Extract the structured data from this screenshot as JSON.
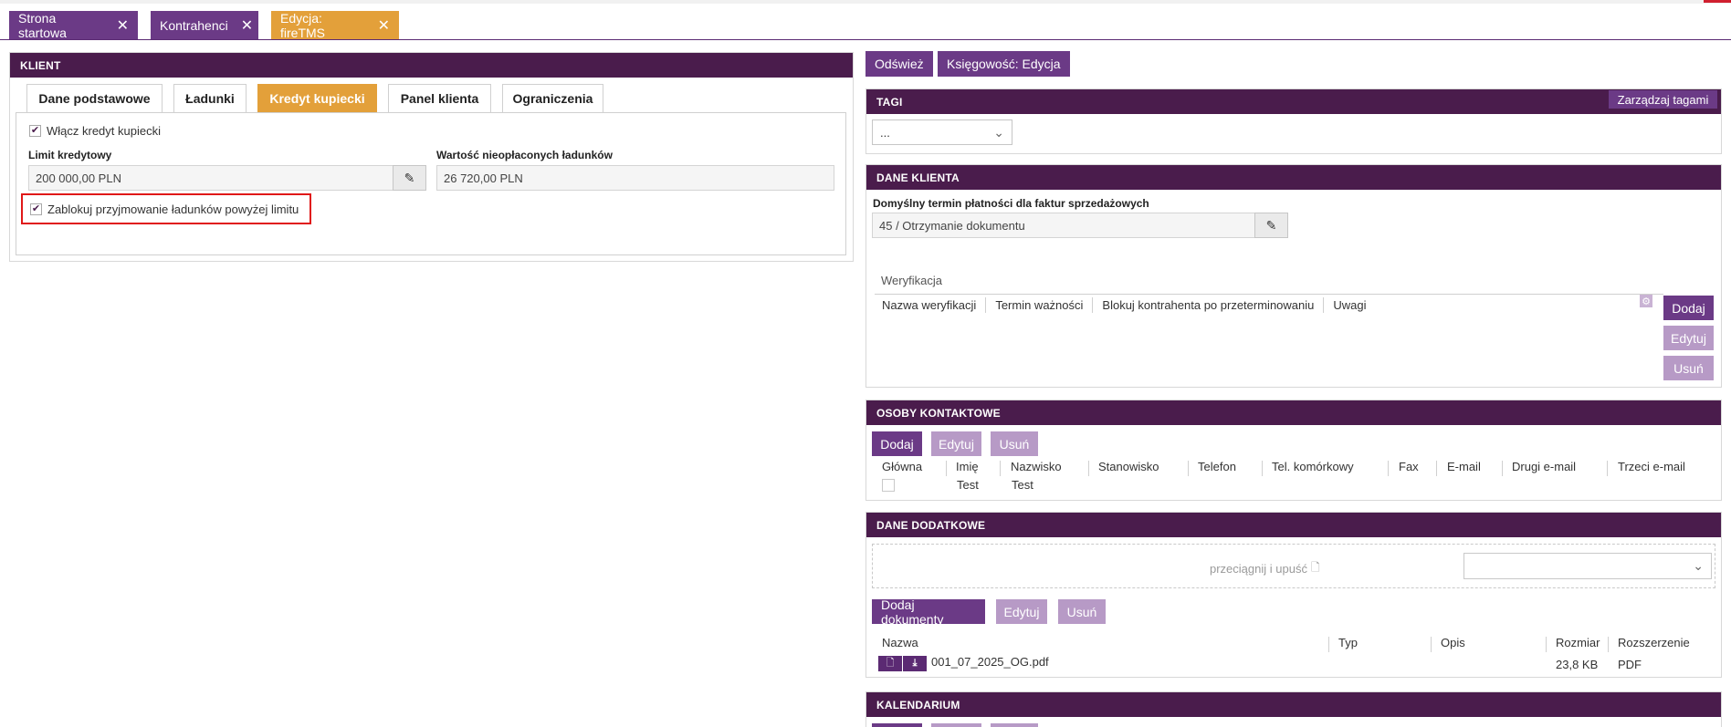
{
  "tabs": [
    {
      "label": "Strona startowa"
    },
    {
      "label": "Kontrahenci"
    },
    {
      "label": "Edycja: fireTMS"
    }
  ],
  "client": {
    "title": "KLIENT",
    "subtabs": [
      "Dane podstawowe",
      "Ładunki",
      "Kredyt kupiecki",
      "Panel klienta",
      "Ograniczenia"
    ],
    "enable_credit_label": "Włącz kredyt kupiecki",
    "credit_limit_label": "Limit kredytowy",
    "credit_limit_value": "200 000,00 PLN",
    "unpaid_label": "Wartość nieopłaconych ładunków",
    "unpaid_value": "26 720,00 PLN",
    "block_label": "Zablokuj przyjmowanie ładunków powyżej limitu"
  },
  "toolbar": {
    "refresh": "Odśwież",
    "accounting": "Księgowość: Edycja"
  },
  "tags": {
    "title": "TAGI",
    "manage": "Zarządzaj tagami",
    "select_value": "..."
  },
  "client_data": {
    "title": "DANE KLIENTA",
    "payment_term_label": "Domyślny termin płatności dla faktur sprzedażowych",
    "payment_term_value": "45 / Otrzymanie dokumentu",
    "verification_label": "Weryfikacja",
    "columns": [
      "Nazwa weryfikacji",
      "Termin ważności",
      "Blokuj kontrahenta po przeterminowaniu",
      "Uwagi"
    ],
    "add": "Dodaj",
    "edit": "Edytuj",
    "delete": "Usuń"
  },
  "contacts": {
    "title": "OSOBY KONTAKTOWE",
    "add": "Dodaj",
    "edit": "Edytuj",
    "delete": "Usuń",
    "columns": [
      "Główna",
      "Imię",
      "Nazwisko",
      "Stanowisko",
      "Telefon",
      "Tel. komórkowy",
      "Fax",
      "E-mail",
      "Drugi e-mail",
      "Trzeci e-mail"
    ],
    "row": {
      "first_name": "Test",
      "last_name": "Test"
    }
  },
  "extra": {
    "title": "DANE DODATKOWE",
    "dropzone": "przeciągnij i upuść",
    "add_docs": "Dodaj dokumenty",
    "edit": "Edytuj",
    "delete": "Usuń",
    "columns": [
      "Nazwa",
      "Typ",
      "Opis",
      "Rozmiar",
      "Rozszerzenie"
    ],
    "file": {
      "name": "001_07_2025_OG.pdf",
      "size": "23,8 KB",
      "ext": "PDF"
    }
  },
  "calendar": {
    "title": "KALENDARIUM"
  }
}
